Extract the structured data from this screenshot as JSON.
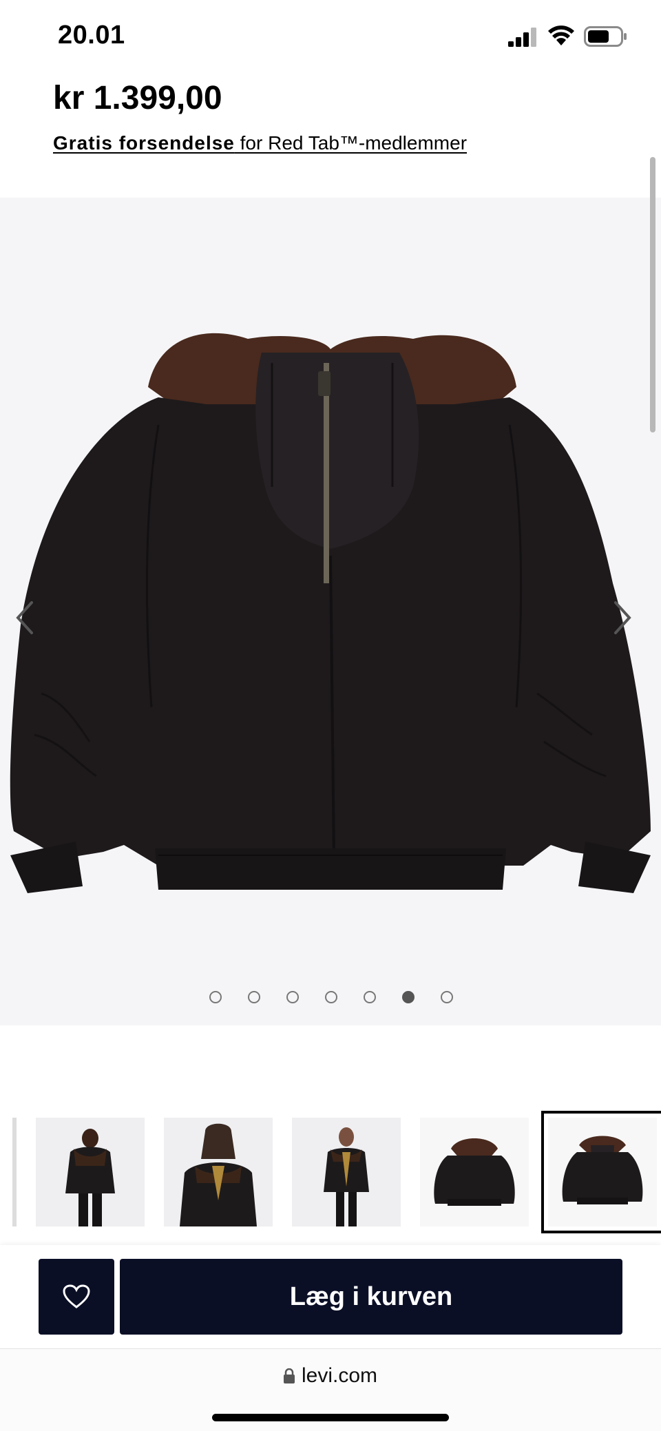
{
  "status_bar": {
    "time": "20.01"
  },
  "product": {
    "price": "kr 1.399,00",
    "shipping_bold": "Gratis forsendelse",
    "shipping_rest": " for Red Tab™-medlemmer"
  },
  "gallery": {
    "total_images": 7,
    "active_index": 5
  },
  "actions": {
    "add_to_cart_label": "Læg i kurven"
  },
  "browser": {
    "url": "levi.com"
  },
  "colors": {
    "button_bg": "#0b0f26",
    "image_bg": "#f5f5f7"
  },
  "icons": [
    "signal-icon",
    "wifi-icon",
    "battery-icon",
    "chevron-left-icon",
    "chevron-right-icon",
    "heart-icon",
    "lock-icon"
  ]
}
